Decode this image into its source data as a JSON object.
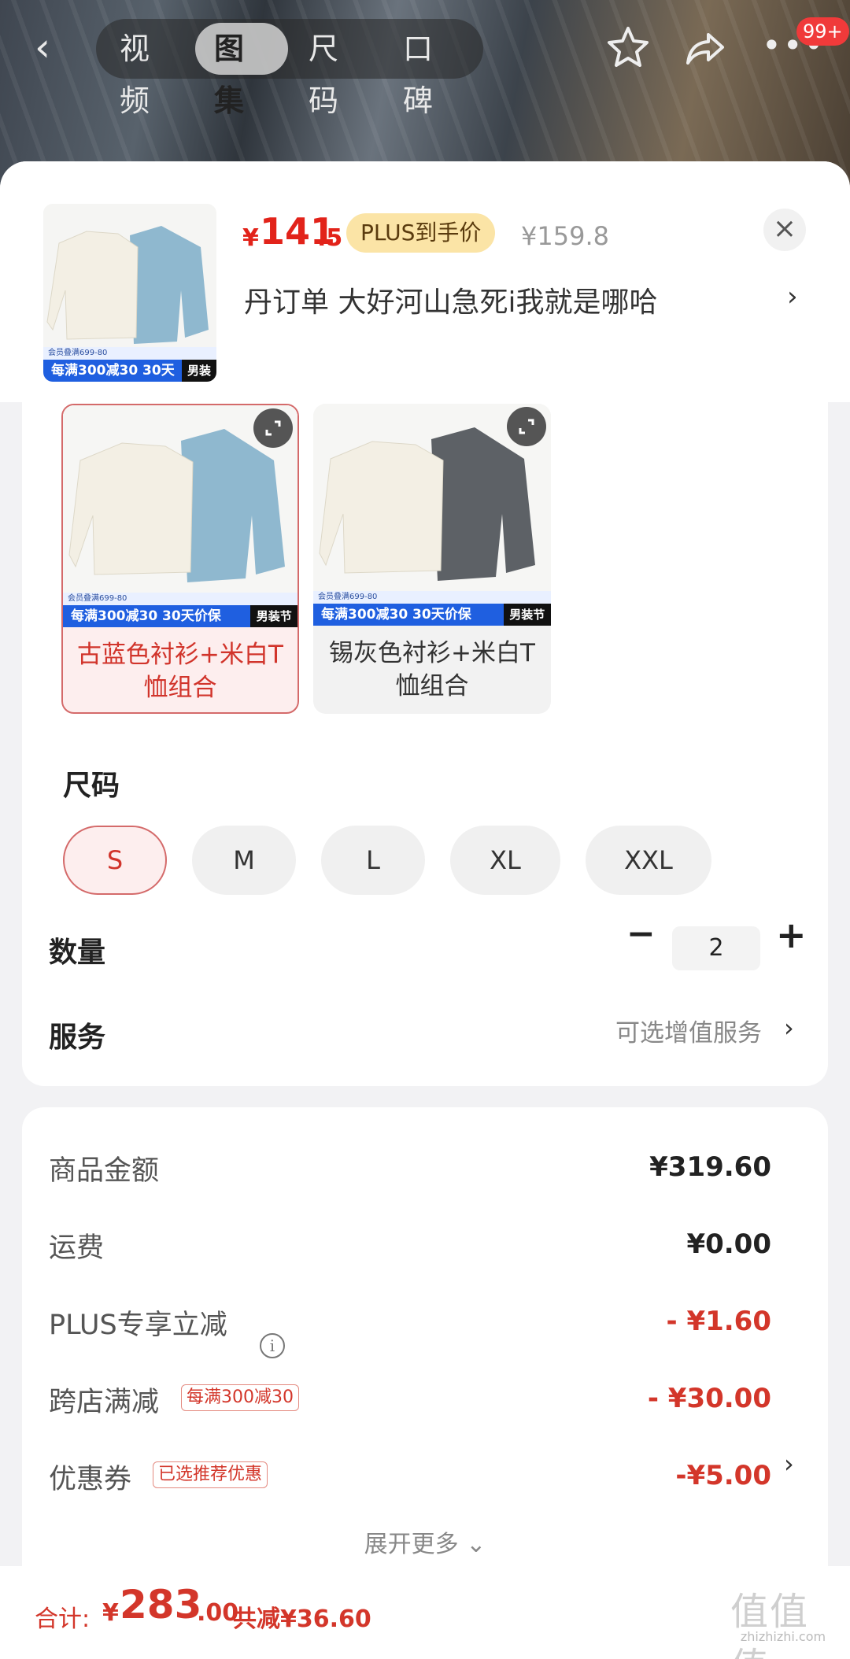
{
  "topbar": {
    "tabs": [
      {
        "label": "视频",
        "active": false
      },
      {
        "label": "图集",
        "active": true
      },
      {
        "label": "尺码",
        "active": false
      },
      {
        "label": "口碑",
        "active": false
      }
    ],
    "badge": "99+",
    "icons": [
      "back-icon",
      "star-icon",
      "share-icon",
      "more-icon"
    ]
  },
  "product": {
    "price_currency": "¥",
    "price_integer": "141",
    "price_decimal": ".5",
    "plus_tag": "PLUS到手价",
    "original_price": "¥159.8",
    "title": "丹订单  大好河山急死i我就是哪哈",
    "chevron": "›",
    "close": "×"
  },
  "promo": {
    "top_text": "会员叠满699-80",
    "main_text": "每满300减30  30天价保",
    "side_text": "男装节"
  },
  "colors": [
    {
      "label": "古蓝色衬衫+米白T恤组合",
      "selected": true,
      "shirt_color": "#8fb8cf"
    },
    {
      "label": "锡灰色衬衫+米白T恤组合",
      "selected": false,
      "shirt_color": "#5d6166"
    }
  ],
  "size": {
    "label": "尺码",
    "options": [
      {
        "label": "S",
        "selected": true
      },
      {
        "label": "M",
        "selected": false
      },
      {
        "label": "L",
        "selected": false
      },
      {
        "label": "XL",
        "selected": false
      },
      {
        "label": "XXL",
        "selected": false
      }
    ]
  },
  "quantity": {
    "label": "数量",
    "value": "2",
    "minus": "−",
    "plus": "+"
  },
  "service": {
    "label": "服务",
    "hint": "可选增值服务",
    "chevron": "›"
  },
  "summary": {
    "goods_label": "商品金额",
    "goods_value": "¥319.60",
    "shipping_label": "运费",
    "shipping_value": "¥0.00",
    "plus_label": "PLUS专享立减",
    "plus_value": "- ¥1.60",
    "cross_label": "跨店满减",
    "cross_tag": "每满300减30",
    "cross_value": "- ¥30.00",
    "coupon_label": "优惠券",
    "coupon_tag": "已选推荐优惠",
    "coupon_value": "-¥5.00",
    "coupon_chevron": "›",
    "expand_more": "展开更多 ⌄"
  },
  "bottom": {
    "total_label": "合计:",
    "total_currency": "¥",
    "total_integer": "283",
    "total_decimal": ".00",
    "total_save": "共减¥36.60"
  },
  "watermark": {
    "text": "zhizhizhi.com"
  },
  "colors_theme": {
    "accent_red": "#e2231a",
    "plus_gold": "#fbe4a6",
    "selected_bg": "#fdeeee"
  }
}
